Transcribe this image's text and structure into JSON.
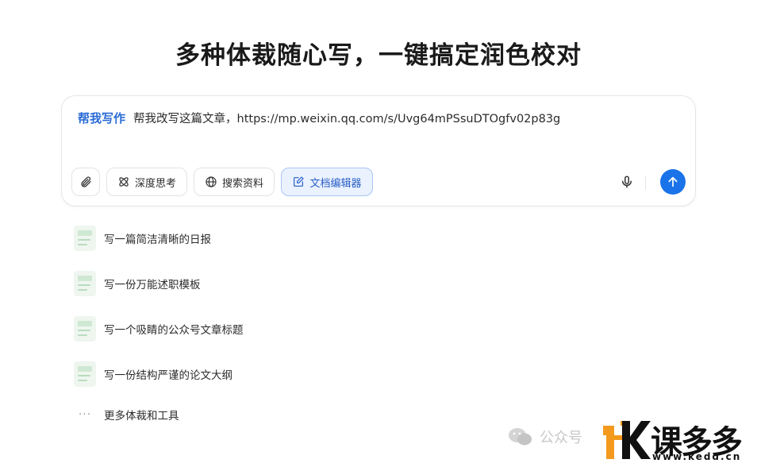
{
  "headline": "多种体裁随心写，一键搞定润色校对",
  "composer": {
    "skill_tag": "帮我写作",
    "prompt_text": "帮我改写这篇文章，https://mp.weixin.qq.com/s/Uvg64mPSsuDTOgfv02p83g",
    "tools": {
      "deep_think": "深度思考",
      "search": "搜索资料",
      "editor": "文档编辑器"
    }
  },
  "suggestions": [
    {
      "label": "写一篇简洁清晰的日报"
    },
    {
      "label": "写一份万能述职模板"
    },
    {
      "label": "写一个吸睛的公众号文章标题"
    },
    {
      "label": "写一份结构严谨的论文大纲"
    }
  ],
  "more": {
    "dots": "···",
    "label": "更多体裁和工具"
  },
  "watermark": {
    "text": "公众号"
  },
  "brand": {
    "name": "课多多",
    "url": "www.kedd.cn"
  },
  "colors": {
    "accent": "#1a73e8",
    "skill_tag": "#2a6bd6",
    "active_tool_bg": "#eaf1ff"
  }
}
